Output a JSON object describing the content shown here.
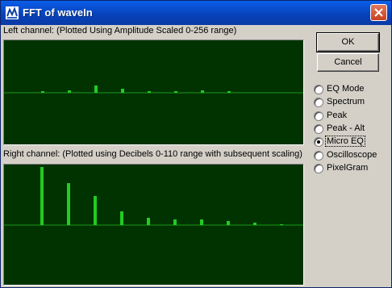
{
  "window": {
    "title": "FFT of waveIn"
  },
  "left_channel": {
    "label": "Left channel: (Plotted Using Amplitude Scaled 0-256 range)"
  },
  "right_channel": {
    "label": "Right channel: (Plotted using Decibels 0-110 range with subsequent scaling)"
  },
  "buttons": {
    "ok": "OK",
    "cancel": "Cancel"
  },
  "modes": [
    {
      "label": "EQ Mode",
      "selected": false
    },
    {
      "label": "Spectrum",
      "selected": false
    },
    {
      "label": "Peak",
      "selected": false
    },
    {
      "label": "Peak - Alt",
      "selected": false
    },
    {
      "label": "Micro EQ",
      "selected": true
    },
    {
      "label": "Oscilloscope",
      "selected": false
    },
    {
      "label": "PixelGram",
      "selected": false
    }
  ],
  "chart_data": [
    {
      "type": "bar",
      "name": "left",
      "values": [
        2,
        3,
        11,
        6,
        2,
        2,
        3,
        2
      ],
      "ylim": [
        0,
        256
      ]
    },
    {
      "type": "bar",
      "name": "right",
      "values": [
        110,
        80,
        55,
        26,
        13,
        10,
        10,
        7,
        5,
        2
      ],
      "ylim": [
        0,
        110
      ]
    }
  ],
  "colors": {
    "plot_bg": "#003300",
    "bar": "#22cc22",
    "baseline": "#1a9a1a"
  }
}
